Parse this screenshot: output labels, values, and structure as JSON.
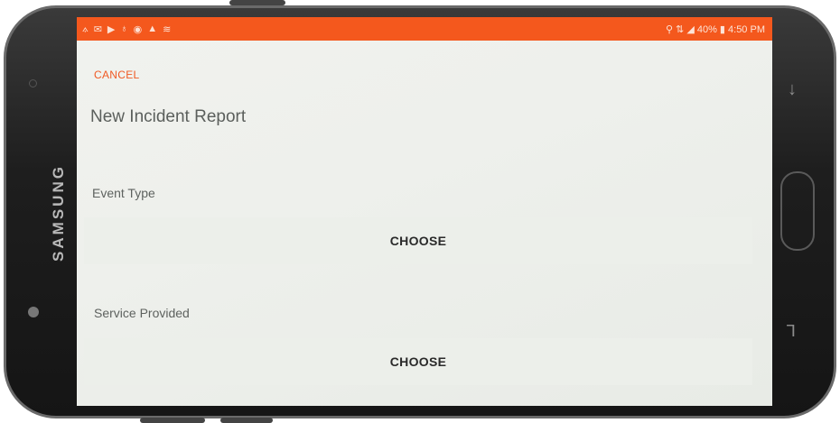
{
  "device": {
    "brand": "SAMSUNG"
  },
  "statusbar": {
    "left_icons": [
      "⟑",
      "✉",
      "▶",
      "♁",
      "◉",
      "▲",
      "≋"
    ],
    "right_text": "⚲ ⇅ ◢ 40% ▮ 4:50 PM"
  },
  "app": {
    "cancel_label": "CANCEL",
    "title": "New Incident Report",
    "fields": [
      {
        "label": "Event Type",
        "button": "CHOOSE"
      },
      {
        "label": "Service Provided",
        "button": "CHOOSE"
      }
    ]
  },
  "nav": {
    "back_glyph": "↓",
    "recent_glyph": "⅂"
  },
  "colors": {
    "accent": "#f4581d",
    "cancel": "#f05a24"
  }
}
